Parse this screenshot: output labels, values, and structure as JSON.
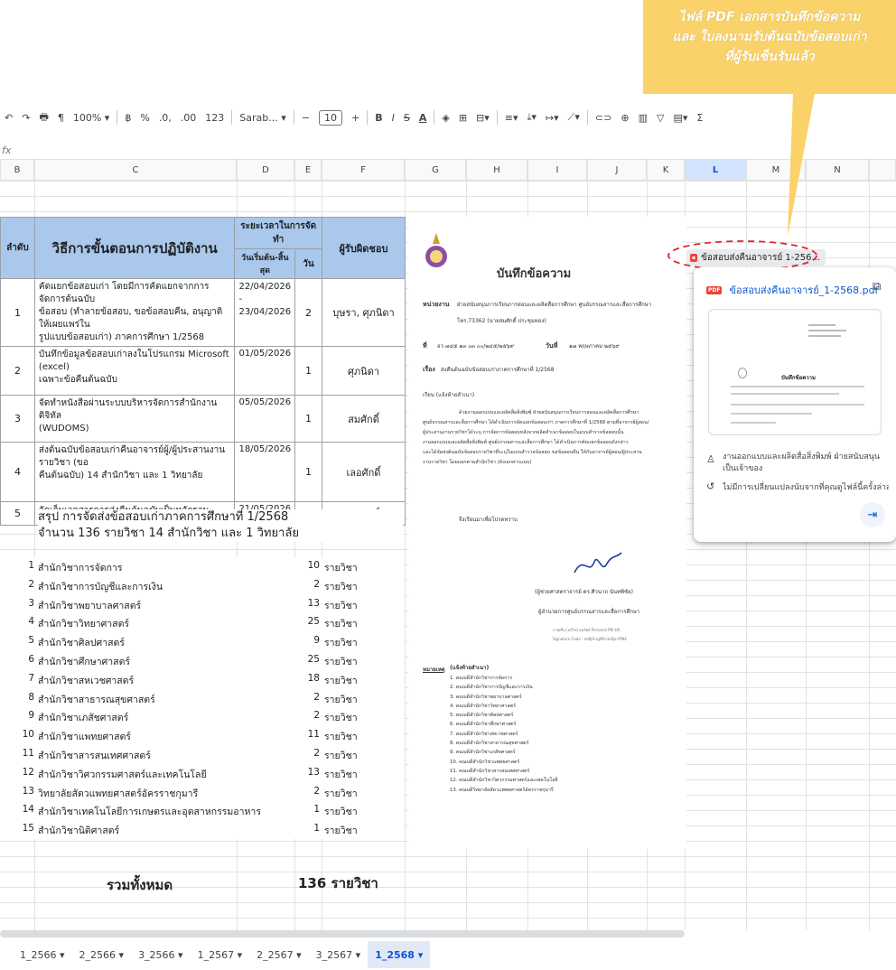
{
  "callout": {
    "lines": [
      "ไฟล์ PDF เอกสารบันทึกข้อความ",
      "และ ใบลงนามรับต้นฉบับข้อสอบเก่า",
      "ที่ผู้รับเซ็นรับแล้ว"
    ],
    "color": "#f9d26a"
  },
  "toolbar": {
    "zoom": "100%",
    "currency": "฿",
    "percent": "%",
    "dec_less": ".0,",
    "dec_more": ".00",
    "num_fmt": "123",
    "font": "Sarab...",
    "font_size": "10",
    "bold": "B",
    "italic": "I",
    "strike": "S",
    "text_color": "A",
    "sigma": "Σ"
  },
  "formula_bar": {
    "fx": "fx"
  },
  "columns": [
    "B",
    "C",
    "D",
    "E",
    "F",
    "G",
    "H",
    "I",
    "J",
    "K",
    "L",
    "M",
    "N"
  ],
  "table": {
    "headers": {
      "order": "ลำดับ",
      "method": "วิธีการขั้นตอนการปฏิบัติงาน",
      "period": "ระยะเวลาในการจัดทำ",
      "start_end": "วันเริ่มต้น-สิ้นสุด",
      "days": "วัน",
      "owner": "ผู้รับผิดชอบ"
    },
    "rows": [
      {
        "no": "1",
        "method": [
          "คัดแยกข้อสอบเก่า โดยมีการคัดแยกจากการจัดการต้นฉบับ",
          "ข้อสอบ (ทำลายข้อสอบ, ขอข้อสอบคืน, อนุญาติให้เผยแพร่ใน",
          "รูปแบบข้อสอบเก่า) ภาคการศึกษา 1/2568"
        ],
        "date": [
          "22/04/2026 -",
          "23/04/2026"
        ],
        "days": "2",
        "owner": "บุษรา, ศุภนิดา"
      },
      {
        "no": "2",
        "method": [
          "บันทึกข้อมูลข้อสอบเก่าลงในโปรแกรม Microsoft (excel)",
          "เฉพาะข้อคืนต้นฉบับ"
        ],
        "date": [
          "01/05/2026"
        ],
        "days": "1",
        "owner": "ศุภนิดา"
      },
      {
        "no": "3",
        "method": [
          "จัดทำหนังสือผ่านระบบบริหารจัดการสำนักงานดิจิทัล",
          "(WUDOMS)"
        ],
        "date": [
          "05/05/2026"
        ],
        "days": "1",
        "owner": "สมศักดิ์"
      },
      {
        "no": "4",
        "method": [
          "ส่งต้นฉบับข้อสอบเก่าคืนอาจารย์ผู้/ผู้ประสานงานรายวิชา (ขอ",
          "คืนต้นฉบับ) 14 สำนักวิชา และ 1 วิทยาลัย"
        ],
        "date": [
          "18/05/2026"
        ],
        "days": "1",
        "owner": "เลอศักดิ์"
      },
      {
        "no": "5",
        "method": [
          "จัดเก็บเอกสารการส่งคืนต้นฉบับเป็นหลักฐาน"
        ],
        "date": [
          "21/05/2026"
        ],
        "days": "1",
        "owner": "สมศักดิ์"
      }
    ]
  },
  "summary": {
    "line1": "สรุป การจัดส่งข้อสอบเก่าภาคการศึกษาที่ 1/2568",
    "line2": "จำนวน 136 รายวิชา  14 สำนักวิชา และ 1 วิทยาลัย"
  },
  "schools": [
    {
      "no": "1",
      "name": "สำนักวิชาการจัดการ",
      "count": "10",
      "unit": "รายวิชา"
    },
    {
      "no": "2",
      "name": "สำนักวิชาการบัญชีและการเงิน",
      "count": "2",
      "unit": "รายวิชา"
    },
    {
      "no": "3",
      "name": "สำนักวิชาพยาบาลศาสตร์",
      "count": "13",
      "unit": "รายวิชา"
    },
    {
      "no": "4",
      "name": "สำนักวิชาวิทยาศาสตร์",
      "count": "25",
      "unit": "รายวิชา"
    },
    {
      "no": "5",
      "name": "สำนักวิชาศิลปศาสตร์",
      "count": "9",
      "unit": "รายวิชา"
    },
    {
      "no": "6",
      "name": "สำนักวิชาศึกษาศาสตร์",
      "count": "25",
      "unit": "รายวิชา"
    },
    {
      "no": "7",
      "name": "สำนักวิชาสหเวชศาสตร์",
      "count": "18",
      "unit": "รายวิชา"
    },
    {
      "no": "8",
      "name": "สำนักวิชาสาธารณสุขศาสตร์",
      "count": "2",
      "unit": "รายวิชา"
    },
    {
      "no": "9",
      "name": "สำนักวิชาเภสัชศาสตร์",
      "count": "2",
      "unit": "รายวิชา"
    },
    {
      "no": "10",
      "name": "สำนักวิชาแพทยศาสตร์",
      "count": "11",
      "unit": "รายวิชา"
    },
    {
      "no": "11",
      "name": "สำนักวิชาสารสนเทศศาสตร์",
      "count": "2",
      "unit": "รายวิชา"
    },
    {
      "no": "12",
      "name": "สำนักวิชาวิศวกรรมศาสตร์และเทคโนโลยี",
      "count": "13",
      "unit": "รายวิชา"
    },
    {
      "no": "13",
      "name": "วิทยาลัยสัตวแพทยศาสตร์อัครราชกุมารี",
      "count": "2",
      "unit": "รายวิชา"
    },
    {
      "no": "14",
      "name": "สำนักวิชาเทคโนโลยีการเกษตรและอุตสาหกรรมอาหาร",
      "count": "1",
      "unit": "รายวิชา"
    },
    {
      "no": "15",
      "name": "สำนักวิชานิติศาสตร์",
      "count": "1",
      "unit": "รายวิชา"
    }
  ],
  "total": {
    "label": "รวมทั้งหมด",
    "count": "136",
    "unit": "รายวิชา"
  },
  "memo": {
    "title": "บันทึกข้อความ",
    "dept_label": "หน่วยงาน",
    "dept_value": "ฝ่ายสนับสนุนการเรียนการสอนและผลิตสื่อการศึกษา ศูนย์บรรณสารและสื่อการศึกษา",
    "phone": "โทร.73362 (นายสมศักดิ์ ประชุมทอง)",
    "no_label": "ที่",
    "no_value": "อว ๗๔๕ ๑๓ ๐๓ ๐๐/๒๔๕/๒๕๖๙",
    "date_label": "วันที่",
    "date_value": "๑๗ พฤษภาคม ๒๕๖๙",
    "subject_label": "เรื่อง",
    "subject_value": "ส่งคืนต้นฉบับข้อสอบเก่าภาคการศึกษาที่ 1/2568",
    "to": "เรียน  (แจ้งท้ายสำเนา)",
    "body": [
      "ด้วยงานออกแบบและผลิตสื่อสิ่งพิมพ์ ฝ่ายสนับสนุนการเรียนการสอนและผลิตสื่อการศึกษา",
      "ศูนย์บรรณสารและสื่อการศึกษา ได้ดำเนินการคัดแยกข้อสอบเก่า ภาคการศึกษาที่ 1/2568 ตามที่อาจารย์ผู้สอน/",
      "ผู้ประสานงานรายวิชาได้ระบุ การจัดการข้อสอบหลังจากผลิตสำเนาข้อสอบในแบบสำรวจข้อสอบนั้น",
      "งานออกแบบและผลิตสื่อสิ่งพิมพ์ ศูนย์บรรณสารและสื่อการศึกษา ได้ดำเนินการคัดแยกข้อสอบดังกล่าว",
      "และได้จัดส่งต้นฉบับข้อสอบรายวิชาที่ระบุในแบบสำรวจข้อสอบ ขอข้อสอบคืน ให้กับอาจารย์ผู้สอน/ผู้ประสาน",
      "งานรายวิชา โดยแยกตามสำนักวิชา (ดังเอกสารแนบ)"
    ],
    "closing": "จึงเรียนมาเพื่อโปรดทราบ",
    "signer_name": "(ผู้ช่วยศาสตราจารย์ ดร.ศิวนาถ นันทพิชัย)",
    "signer_title": "ผู้อำนวยการศูนย์บรรณสารและสื่อการศึกษา",
    "sig_meta1": "ลายเซ็น (แก้ไข)  ผลลัพธ์  Personal PKI-LN",
    "sig_meta2": "Signature Code : ed8j9-sgM0-dv6jo-YPN4",
    "cc_label": "หมายเหตุ",
    "cc_title": "(แจ้งท้ายสำเนา)",
    "cc_list": [
      "1. คณบดีสำนักวิชาการจัดการ",
      "2. คณบดีสำนักวิชาการบัญชีและการเงิน",
      "3. คณบดีสำนักวิชาพยาบาลศาสตร์",
      "4. คณบดีสำนักวิชาวิทยาศาสตร์",
      "5. คณบดีสำนักวิชาศิลปศาสตร์",
      "6. คณบดีสำนักวิชาศึกษาศาสตร์",
      "7. คณบดีสำนักวิชาสหเวชศาสตร์",
      "8. คณบดีสำนักวิชาสาธารณสุขศาสตร์",
      "9. คณบดีสำนักวิชาเภสัชศาสตร์",
      "10. คณบดีสำนักวิชาแพทยศาสตร์",
      "11. คณบดีสำนักวิชาสารสนเทศศาสตร์",
      "12. คณบดีสำนักวิชาวิศวกรรมศาสตร์และเทคโนโลยี",
      "13. คณบดีวิทยาลัยสัตวแพทยศาสตร์อัครราชกุมารี"
    ]
  },
  "chip": {
    "label": "ข้อสอบส่งคืนอาจารย์ 1-256..."
  },
  "popup": {
    "file_name": "ข้อสอบส่งคืนอาจารย์_1-2568.pdf",
    "badge": "PDF",
    "owner": "งานออกแบบและผลิตสื่อสิ่งพิมพ์ ฝ่ายสนับสนุนเป็นเจ้าของ",
    "history": "ไม่มีการเปลี่ยนแปลงนับจากที่คุณดูไฟล์นี้ครั้งล่าสุด",
    "thumb_title": "บันทึกข้อความ"
  },
  "sheet_tabs": [
    "1_2566",
    "2_2566",
    "3_2566",
    "1_2567",
    "2_2567",
    "3_2567",
    "1_2568"
  ],
  "active_tab": "1_2568",
  "colors": {
    "header_blue": "#a9c8ec",
    "accent": "#0b57d0",
    "pdf_red": "#ea4335",
    "dash_red": "#e0262b"
  }
}
